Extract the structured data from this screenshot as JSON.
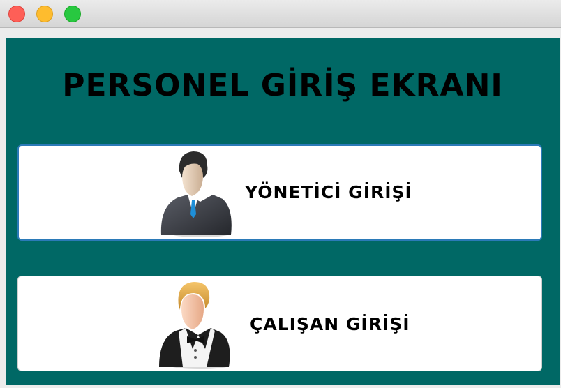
{
  "window": {
    "controls": [
      "close",
      "minimize",
      "zoom"
    ]
  },
  "main": {
    "title": "PERSONEL GİRİŞ EKRANI",
    "buttons": [
      {
        "label": "YÖNETİCİ GİRİŞİ",
        "icon": "manager-avatar-icon"
      },
      {
        "label": "ÇALIŞAN GİRİŞİ",
        "icon": "waiter-avatar-icon"
      }
    ]
  },
  "colors": {
    "background": "#006865",
    "card": "#ffffff",
    "focus_border": "#2b7ab8",
    "close": "#fe5f57",
    "minimize": "#febc2e",
    "zoom": "#28c840"
  }
}
